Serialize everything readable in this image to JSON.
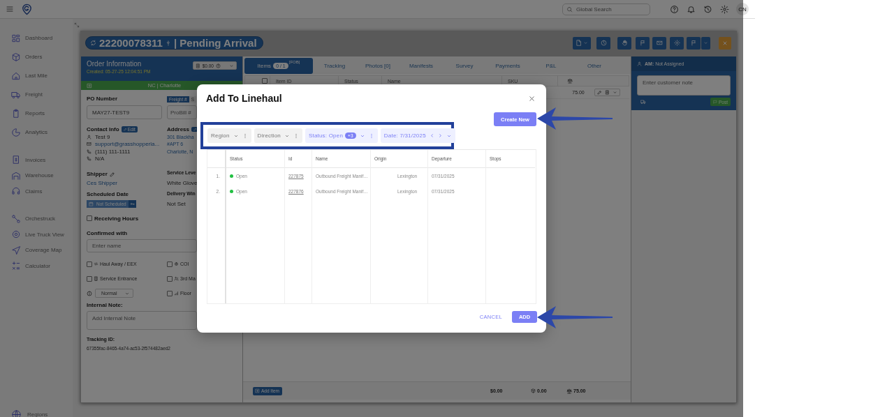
{
  "top_bar": {
    "search_placeholder": "Global Search",
    "avatar": "CN"
  },
  "nav": {
    "sections": [
      [
        "Dashboard",
        "Orders",
        "Last Mile",
        "Freight",
        "Reports",
        "Analytics"
      ],
      [
        "Invoices",
        "Warehouse",
        "Claims"
      ],
      [
        "Orchestruck",
        "Live Truck View",
        "Coverage Map",
        "Calculator"
      ]
    ],
    "footer": "Regions"
  },
  "order": {
    "number": "22200078311",
    "status": "| Pending Arrival"
  },
  "info": {
    "title": "Order Information",
    "created": "Created: 05-27-25 12:04:51 PM",
    "total": "$0.00",
    "location": "NC | Charlotte",
    "po": {
      "label": "PO Number",
      "value": "MAY27-TEST9"
    },
    "ref_tabs": [
      {
        "label": "Freight #",
        "selected": true
      },
      {
        "label": "S",
        "selected": false
      }
    ],
    "probill_placeholder": "ProBill #",
    "contact": {
      "label": "Contact Info",
      "edit": "Edit",
      "lines": [
        {
          "kind": "name",
          "text": "Test 9"
        },
        {
          "kind": "email",
          "text": "support@grasshopperla..."
        },
        {
          "kind": "phone",
          "text": "(111) 111-1111"
        },
        {
          "kind": "phone",
          "text": "N/A"
        }
      ]
    },
    "address": {
      "label": "Address",
      "lines": [
        "301 Blackha",
        "#APT 6",
        "Charlotte, N"
      ]
    },
    "shipper": {
      "label": "Shipper",
      "value": "Ces Shipper"
    },
    "service_level": {
      "label": "Service Leve",
      "value": "White Glove"
    },
    "scheduled_date": {
      "label": "Scheduled Date",
      "value": "Not Scheduled"
    },
    "delivery_window": {
      "label": "Delivery Win",
      "value": "Not Set"
    },
    "receiving_hours": {
      "label": "Receiving Hours",
      "checked": false
    },
    "confirmed_with": {
      "label": "Confirmed with",
      "placeholder": "Enter name"
    },
    "options": [
      {
        "kind": "checkbox",
        "label": "Haul Away / EEX",
        "checked": false
      },
      {
        "kind": "checkbox",
        "label": "COI",
        "checked": false
      },
      {
        "kind": "checkbox",
        "label": "Service Entrance",
        "checked": false
      },
      {
        "kind": "checkbox",
        "label": "3rd Ma",
        "checked": false
      },
      {
        "kind": "select",
        "value": "Normal"
      },
      {
        "kind": "checkbox",
        "label": "Floor",
        "checked": false
      }
    ],
    "internal_note": {
      "label": "Internal Note:",
      "placeholder": "Add Internal Note"
    },
    "tracking": {
      "label": "Tracking ID:",
      "value": "67355fac-8465-4a74-ac53-2f574482aed2"
    }
  },
  "tabs": [
    {
      "label": "Items",
      "badge": "0 / 1",
      "note": "[FOB]",
      "selected": true
    },
    {
      "label": "Tracking",
      "selected": false
    },
    {
      "label": "Photos [0]",
      "selected": false
    },
    {
      "label": "Manifests",
      "selected": false
    },
    {
      "label": "Survey",
      "selected": false
    },
    {
      "label": "Payments",
      "selected": false
    },
    {
      "label": "P&L",
      "selected": false
    },
    {
      "label": "Other",
      "selected": false
    }
  ],
  "items": {
    "select_all": {
      "checked": false
    },
    "columns": [
      "Item ID",
      "Status",
      "Name",
      "SKU"
    ],
    "rows": [
      {
        "weight": "75.00"
      }
    ],
    "footer": {
      "add": "Add Item",
      "total": "$0.00",
      "volume": "0.00",
      "weight": "75.00"
    }
  },
  "customer_panel": {
    "title": "**AM:** Not Assigned",
    "placeholder": "Enter customer note",
    "post": "Post"
  },
  "modal": {
    "title": "Add To Linehaul",
    "create": "Create New",
    "filters": [
      {
        "kind": "select",
        "label": "Region",
        "active": false
      },
      {
        "kind": "select",
        "label": "Direction",
        "active": false
      },
      {
        "kind": "select",
        "label": "Status: Open",
        "badge": "+3",
        "active": true
      },
      {
        "kind": "date",
        "label": "Date: 7/31/2025",
        "active": true
      }
    ],
    "columns": [
      "Status",
      "Id",
      "Name",
      "Origin",
      "Departure",
      "Stops"
    ],
    "rows": [
      {
        "index": "1.",
        "status": "Open",
        "color": "#22c043",
        "id": "227875",
        "name": "Outbound Freight Manif…",
        "origin": "Lexington",
        "departure": "07/31/2025"
      },
      {
        "index": "2.",
        "status": "Open",
        "color": "#22c043",
        "id": "227876",
        "name": "Outbound Freight Manif…",
        "origin": "Lexington",
        "departure": "07/31/2025"
      }
    ],
    "cancel": "CANCEL",
    "add": "ADD"
  }
}
